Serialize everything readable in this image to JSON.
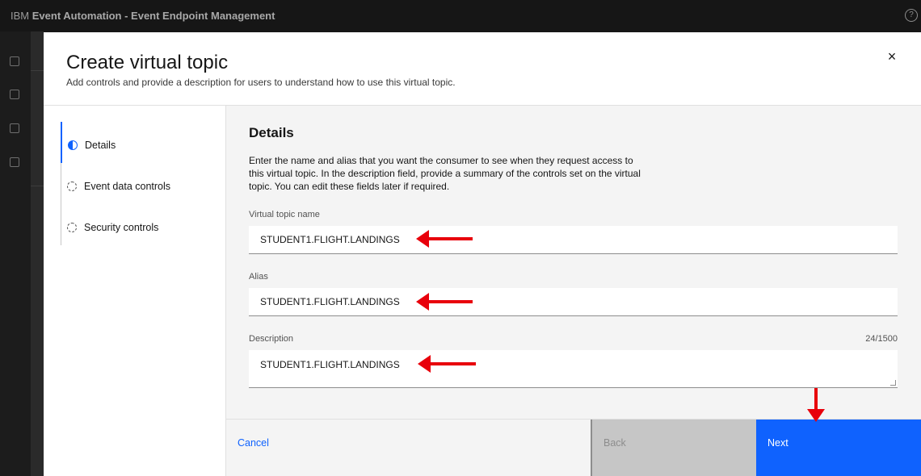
{
  "app": {
    "brand_prefix": "IBM",
    "title": "Event Automation - Event Endpoint Management",
    "help_icon": "help-icon"
  },
  "modal": {
    "title": "Create virtual topic",
    "subtitle": "Add controls and provide a description for users to understand how to use this virtual topic.",
    "close_icon": "×"
  },
  "steps": [
    {
      "label": "Details",
      "state": "current"
    },
    {
      "label": "Event data controls",
      "state": "incomplete"
    },
    {
      "label": "Security controls",
      "state": "incomplete"
    }
  ],
  "form": {
    "heading": "Details",
    "description": "Enter the name and alias that you want the consumer to see when they request access to this virtual topic. In the description field, provide a summary of the controls set on the virtual topic. You can edit these fields later if required.",
    "topic_name": {
      "label": "Virtual topic name",
      "value": "STUDENT1.FLIGHT.LANDINGS"
    },
    "alias": {
      "label": "Alias",
      "value": "STUDENT1.FLIGHT.LANDINGS"
    },
    "description_field": {
      "label": "Description",
      "value": "STUDENT1.FLIGHT.LANDINGS",
      "counter": "24/1500"
    }
  },
  "footer": {
    "cancel": "Cancel",
    "back": "Back",
    "next": "Next"
  },
  "colors": {
    "accent": "#0f62fe",
    "annotation_arrow": "#e8000b",
    "disabled": "#c6c6c6"
  }
}
